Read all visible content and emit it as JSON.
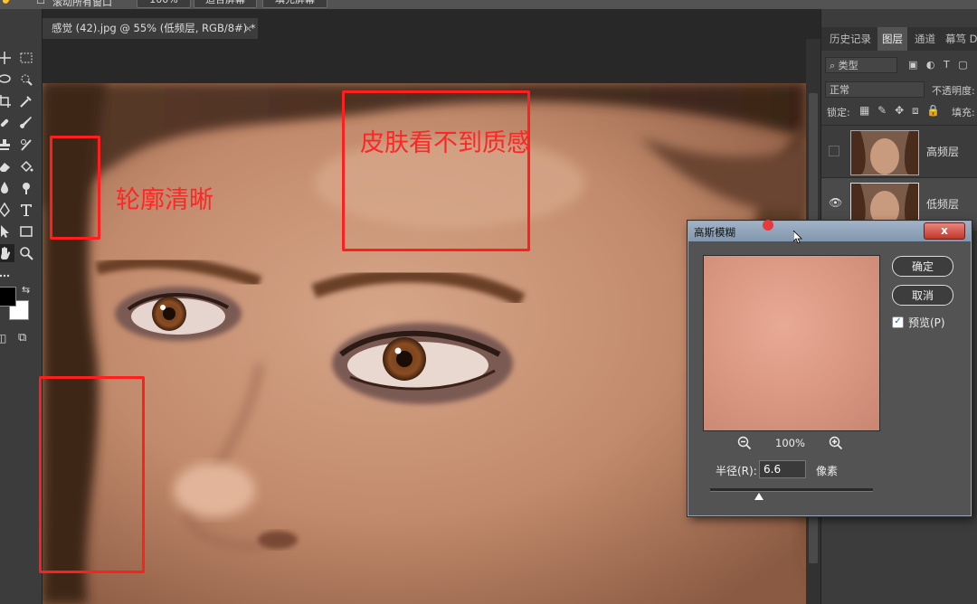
{
  "options_bar": {
    "scroll_all_windows": "滚动所有窗口",
    "zoom": "100%",
    "fit_screen": "适合屏幕",
    "fill_screen": "填充屏幕"
  },
  "document_tab": {
    "title": "感觉 (42).jpg @ 55% (低频层, RGB/8#) *",
    "close": "×"
  },
  "annotations": {
    "contour": "轮廓清晰",
    "skin": "皮肤看不到质感"
  },
  "panel": {
    "tabs": [
      "历史记录",
      "图层",
      "通道",
      "幕笃 DR"
    ],
    "active_tab": "图层",
    "filter_kind": "类型",
    "blend_mode": "正常",
    "opacity_label": "不透明度:",
    "lock_label": "锁定:",
    "fill_label": "填充:",
    "layers": [
      {
        "name": "高频层",
        "visible": false
      },
      {
        "name": "低频层",
        "visible": true
      }
    ]
  },
  "dialog": {
    "title": "高斯模糊",
    "close": "x",
    "ok": "确定",
    "cancel": "取消",
    "preview_label": "预览(P)",
    "preview_checked": true,
    "zoom_level": "100%",
    "radius_label": "半径(R):",
    "radius_value": "6.6",
    "radius_unit": "像素",
    "radius_slider_fraction": 0.3
  },
  "colors": {
    "annotation": "#ff1f1f",
    "ui_dark": "#282828",
    "panel": "#3c3c3c",
    "dialog_title": "#8ea3ba"
  }
}
